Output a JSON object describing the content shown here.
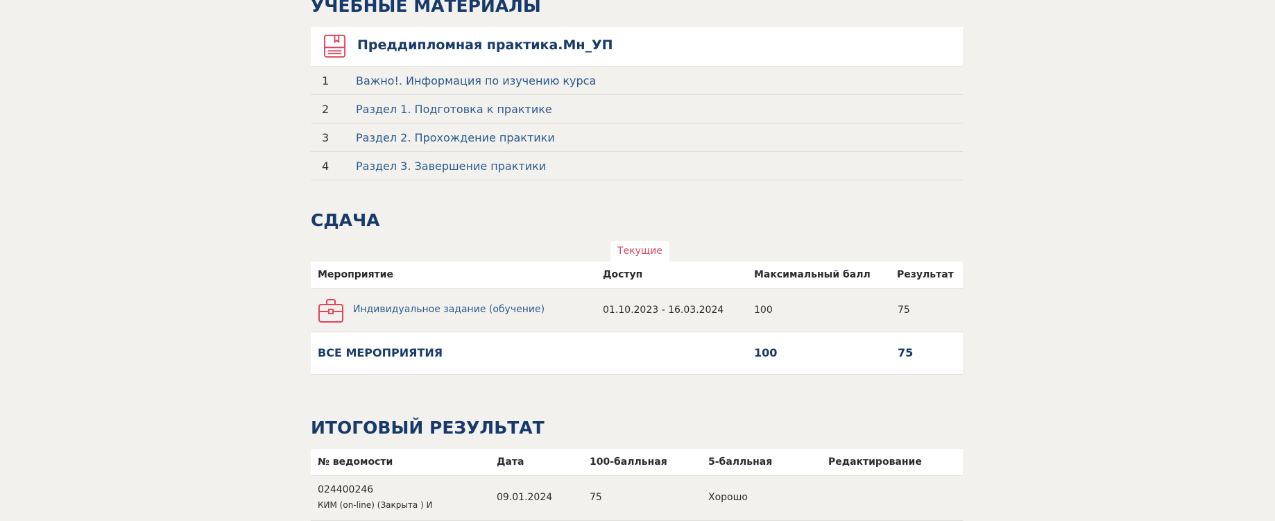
{
  "materials": {
    "title": "УЧЕБНЫЕ МАТЕРИАЛЫ",
    "course_title": "Преддипломная практика.Мн_УП",
    "items": [
      {
        "num": "1",
        "label": "Важно!. Информация по изучению курса"
      },
      {
        "num": "2",
        "label": "Раздел 1. Подготовка к практике"
      },
      {
        "num": "3",
        "label": "Раздел 2. Прохождение практики"
      },
      {
        "num": "4",
        "label": "Раздел 3. Завершение практики"
      }
    ]
  },
  "submission": {
    "title": "СДАЧА",
    "tab_current": "Текущие",
    "columns": {
      "event": "Мероприятие",
      "access": "Доступ",
      "max_score": "Максимальный балл",
      "result": "Результат"
    },
    "rows": [
      {
        "event": "Индивидуальное задание (обучение)",
        "access": "01.10.2023 - 16.03.2024",
        "max_score": "100",
        "result": "75"
      }
    ],
    "total": {
      "label": "ВСЕ МЕРОПРИЯТИЯ",
      "max_score": "100",
      "result": "75"
    }
  },
  "final": {
    "title": "ИТОГОВЫЙ РЕЗУЛЬТАТ",
    "columns": {
      "statement": "№ ведомости",
      "date": "Дата",
      "score100": "100-балльная",
      "score5": "5-балльная",
      "edit": "Редактирование"
    },
    "rows": [
      {
        "statement": "024400246",
        "statement_note": "КИМ (on-line) (Закрыта ) И",
        "date": "09.01.2024",
        "score100": "75",
        "score5": "Хорошо",
        "edit": ""
      }
    ]
  },
  "colors": {
    "heading": "#173a6a",
    "link": "#2d5a8c",
    "accent": "#e2445c",
    "background": "#f2f1ee"
  },
  "icons": {
    "course": "book-icon",
    "event": "briefcase-icon"
  }
}
